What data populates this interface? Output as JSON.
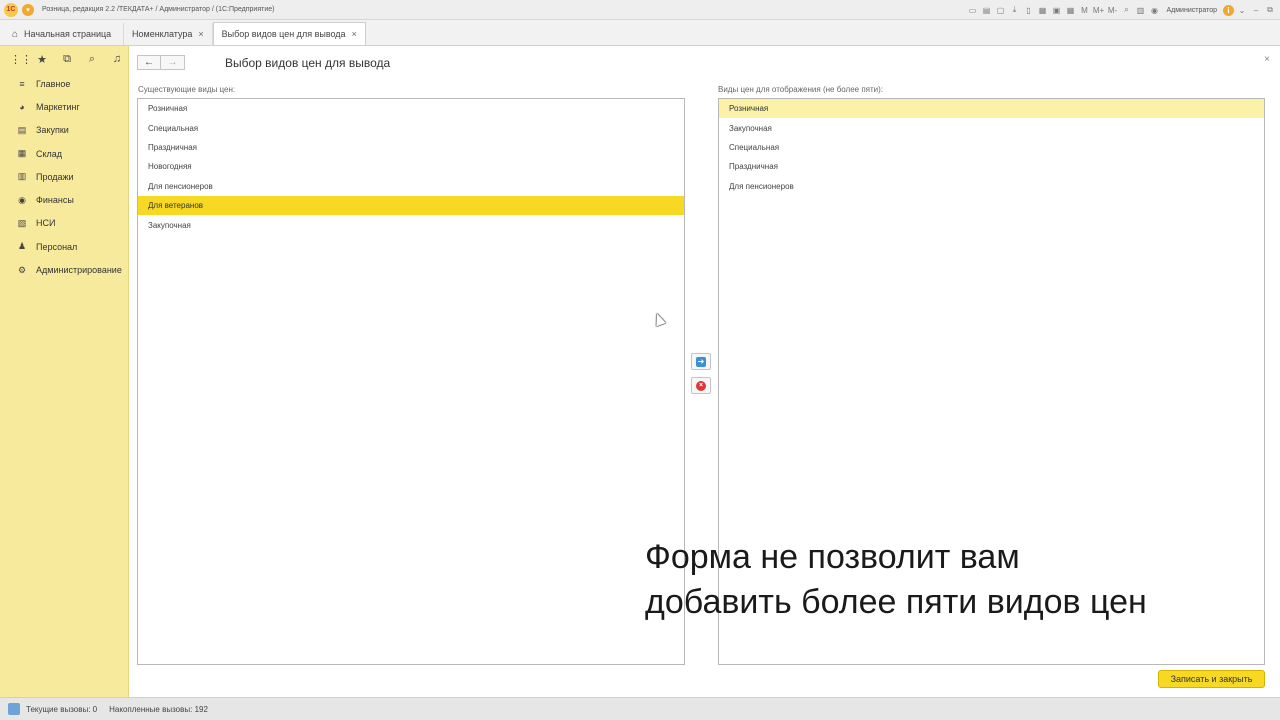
{
  "window": {
    "logo": "1С",
    "title": "Розница, редакция 2.2 /ТЕКДАТА+ / Администратор /  (1С:Предприятие)",
    "user": "Администратор",
    "info": "i",
    "memory_buttons": [
      "M",
      "M+",
      "M-"
    ]
  },
  "tabs": [
    {
      "label": "Начальная страница"
    },
    {
      "label": "Номенклатура"
    },
    {
      "label": "Выбор видов цен для вывода"
    }
  ],
  "sidebar": {
    "items": [
      {
        "label": "Главное",
        "icon": "menu-lines-icon"
      },
      {
        "label": "Маркетинг",
        "icon": "pie-icon"
      },
      {
        "label": "Закупки",
        "icon": "cart-icon"
      },
      {
        "label": "Склад",
        "icon": "warehouse-icon"
      },
      {
        "label": "Продажи",
        "icon": "register-icon"
      },
      {
        "label": "Финансы",
        "icon": "coins-icon"
      },
      {
        "label": "НСИ",
        "icon": "books-icon"
      },
      {
        "label": "Персонал",
        "icon": "person-icon"
      },
      {
        "label": "Администрирование",
        "icon": "gear-icon"
      }
    ]
  },
  "form": {
    "title": "Выбор видов цен для вывода",
    "left_label": "Существующие виды цен:",
    "right_label": "Виды цен для отображения (не более пяти):",
    "left_items": [
      "Розничная",
      "Специальная",
      "Праздничная",
      "Новогодняя",
      "Для пенсионеров",
      "Для ветеранов",
      "Закупочная"
    ],
    "left_selected_index": 5,
    "right_items": [
      "Розничная",
      "Закупочная",
      "Специальная",
      "Праздничная",
      "Для пенсионеров"
    ],
    "right_selected_index": 0,
    "save_button": "Записать и закрыть"
  },
  "caption": "Форма не позволит вам\nдобавить более пяти видов цен",
  "status": {
    "current_calls": "Текущие вызовы: 0",
    "accumulated_calls": "Накопленные вызовы: 192"
  },
  "colors": {
    "sidebar_bg": "#f8ea9c",
    "selection_yellow": "#f7d923",
    "selection_pale": "#fbf2a8",
    "button_yellow": "#f7d923"
  }
}
